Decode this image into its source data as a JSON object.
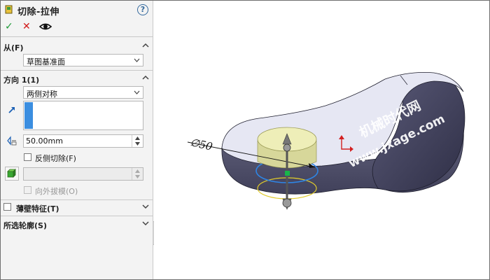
{
  "panel": {
    "title": "切除-拉伸",
    "help_label": "?",
    "actions": {
      "ok": "✓",
      "cancel": "✕"
    },
    "from_section": {
      "label": "从(F)",
      "value": "草图基准面"
    },
    "direction1": {
      "label": "方向 1(1)",
      "end_condition": "两侧对称",
      "depth": "50.00mm",
      "flip_side_label": "反侧切除(F)",
      "draft_value": "",
      "draft_outward_label": "向外拔模(O)"
    },
    "thin_feature": {
      "label": "薄壁特征(T)"
    },
    "selected_contours": {
      "label": "所选轮廓(S)"
    }
  },
  "viewport": {
    "dimension_label": "∅50",
    "watermark_name": "机械时代网",
    "watermark_url": "www.jxage.com"
  },
  "colors": {
    "part_face": "#e6e7f3",
    "part_side": "#4a4a62",
    "boss_fill": "#eeeeb8",
    "preview_ring": "#2e86e6",
    "check_green": "#1e9a37",
    "cancel_red": "#d11919"
  }
}
